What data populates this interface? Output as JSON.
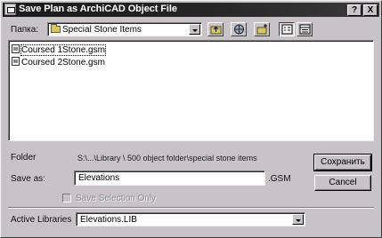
{
  "window": {
    "title": "Save Plan as ArchiCAD Object File",
    "help_glyph": "?",
    "close_glyph": "X"
  },
  "look_in": {
    "label": "Папка:",
    "value": "Special Stone Items",
    "folder_icon": "folder-icon"
  },
  "toolbar": [
    {
      "name": "up-one-level",
      "icon": "up-folder-icon"
    },
    {
      "name": "desktop",
      "icon": "desktop-icon"
    },
    {
      "name": "new-folder",
      "icon": "new-folder-icon"
    },
    {
      "name": "list-view",
      "icon": "list-view-icon",
      "pressed": true
    },
    {
      "name": "details-view",
      "icon": "details-view-icon"
    }
  ],
  "files": [
    {
      "name": "Coursed 1Stone.gsm",
      "selected": true
    },
    {
      "name": "Coursed 2Stone.gsm",
      "selected": false
    }
  ],
  "folder": {
    "label": "Folder",
    "path": "S:\\...\\Library \\ 500 object folder\\special stone items"
  },
  "save_as": {
    "label": "Save as:",
    "value": "Elevations",
    "extension": ".GSM"
  },
  "buttons": {
    "save": "Сохранить",
    "cancel": "Cancel"
  },
  "save_selection_only": {
    "label": "Save Selection Only",
    "checked": false,
    "enabled": false
  },
  "active_libraries": {
    "label": "Active Libraries",
    "value": "Elevations.LIB"
  }
}
